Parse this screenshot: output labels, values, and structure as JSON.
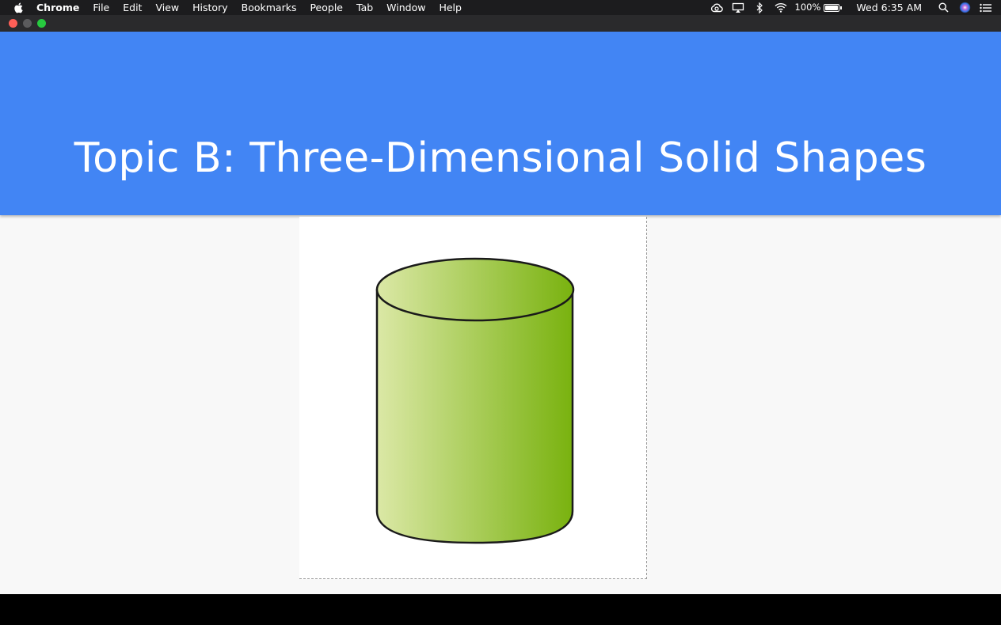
{
  "menubar": {
    "apple_icon": "apple-icon",
    "items": [
      "Chrome",
      "File",
      "Edit",
      "View",
      "History",
      "Bookmarks",
      "People",
      "Tab",
      "Window",
      "Help"
    ],
    "status": {
      "battery_percent": "100%",
      "battery_level": 1.0,
      "clock": "Wed 6:35 AM",
      "icons": [
        "creative-cloud-icon",
        "airplay-icon",
        "bluetooth-icon",
        "wifi-icon",
        "search-icon",
        "siri-icon",
        "notification-center-icon"
      ]
    }
  },
  "window": {
    "traffic_lights": {
      "close": "#fe5f57",
      "minimize": "#5b5b5d",
      "zoom": "#27c93f"
    }
  },
  "slide": {
    "title": "Topic B: Three-Dimensional Solid Shapes",
    "title_band_color": "#4285f4",
    "image": {
      "shape": "cylinder",
      "gradient_from": "#dbe8a6",
      "gradient_to": "#79b20f"
    }
  }
}
